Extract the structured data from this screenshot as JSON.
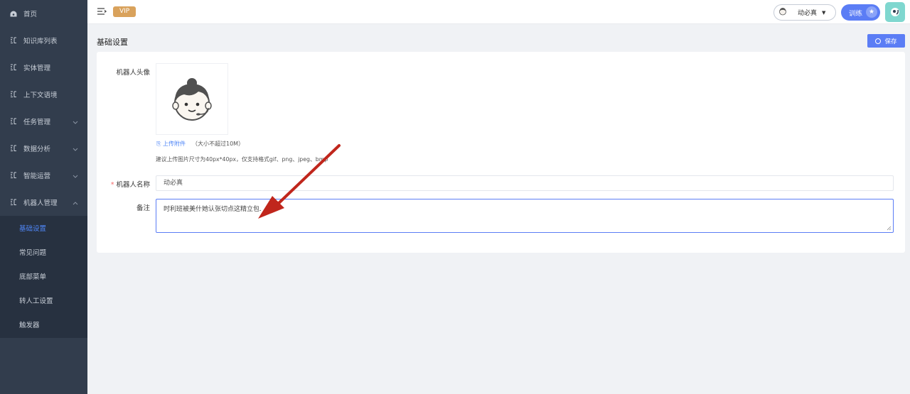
{
  "sidebar": {
    "items": [
      {
        "label": "首页",
        "icon": "dashboard-icon"
      },
      {
        "label": "知识库列表",
        "icon": "list-icon"
      },
      {
        "label": "实体管理",
        "icon": "list-icon"
      },
      {
        "label": "上下文语境",
        "icon": "list-icon"
      },
      {
        "label": "任务管理",
        "icon": "list-icon"
      },
      {
        "label": "数据分析",
        "icon": "list-icon"
      },
      {
        "label": "智能运营",
        "icon": "list-icon"
      },
      {
        "label": "机器人管理",
        "icon": "list-icon"
      }
    ],
    "submenu": [
      {
        "label": "基础设置"
      },
      {
        "label": "常见问题"
      },
      {
        "label": "底部菜单"
      },
      {
        "label": "转人工设置"
      },
      {
        "label": "触发器"
      }
    ]
  },
  "header": {
    "vip": "VIP",
    "user_name": "动必真",
    "train_label": "训练"
  },
  "page": {
    "title": "基础设置",
    "save_label": "保存"
  },
  "form": {
    "avatar_label": "机器人头像",
    "upload_link": "上传附件",
    "upload_note": "（大小不超过10M）",
    "hint": "建议上传图片尺寸为40px*40px，仅支持格式gif、png、jpeg、bmp",
    "required_mark": "*",
    "name_label": "机器人名称",
    "name_value": "动必真",
    "remark_label": "备注",
    "remark_value": "时利班被美什她认张切点这精立包."
  },
  "colors": {
    "sidebar_bg": "#323d4d",
    "accent": "#5b7df5",
    "vip": "#d9a25c",
    "active_text": "#4f86f7",
    "arrow": "#c0261c"
  }
}
